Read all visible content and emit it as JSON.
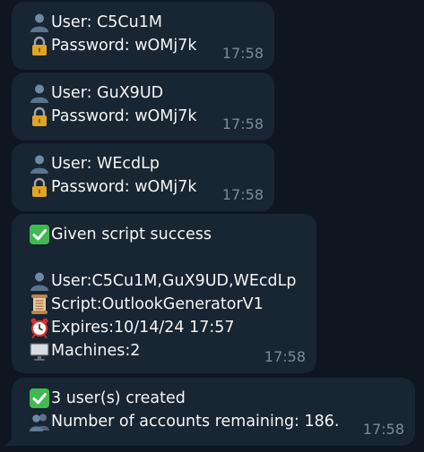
{
  "messages": [
    {
      "lines": [
        {
          "icon": "user-icon",
          "text": "User: C5Cu1M"
        },
        {
          "icon": "lock-icon",
          "text": "Password: wOMj7k"
        }
      ],
      "time": "17:58"
    },
    {
      "lines": [
        {
          "icon": "user-icon",
          "text": "User: GuX9UD"
        },
        {
          "icon": "lock-icon",
          "text": "Password: wOMj7k"
        }
      ],
      "time": "17:58"
    },
    {
      "lines": [
        {
          "icon": "user-icon",
          "text": "User: WEcdLp"
        },
        {
          "icon": "lock-icon",
          "text": "Password: wOMj7k"
        }
      ],
      "time": "17:58"
    },
    {
      "lines": [
        {
          "icon": "check-icon",
          "text": "Given script success"
        },
        {
          "icon": "user-icon",
          "text": "User:C5Cu1M,GuX9UD,WEcdLp"
        },
        {
          "icon": "scroll-icon",
          "text": "Script:OutlookGeneratorV1"
        },
        {
          "icon": "alarm-clock-icon",
          "text": "Expires:10/14/24 17:57"
        },
        {
          "icon": "monitor-icon",
          "text": "Machines:2"
        }
      ],
      "time": "17:58"
    },
    {
      "lines": [
        {
          "icon": "check-icon",
          "text": "3 user(s) created"
        },
        {
          "icon": "users-icon",
          "text": "Number of accounts remaining: 186."
        }
      ],
      "time": "17:58"
    }
  ],
  "colors": {
    "background": "#0e1621",
    "bubble": "#182533",
    "text": "#f5f5f5",
    "time": "#7d8b99",
    "check_green": "#3fb950"
  }
}
